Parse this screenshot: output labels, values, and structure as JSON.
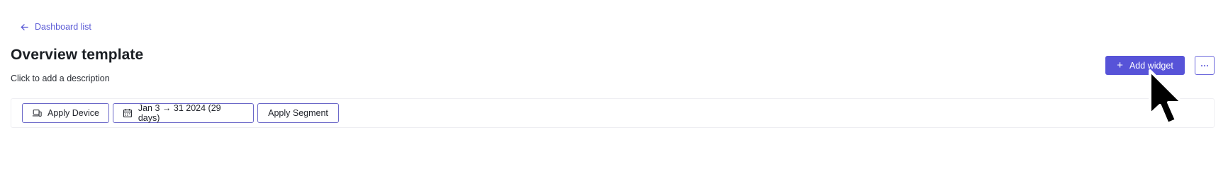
{
  "header": {
    "back_label": "Dashboard list",
    "title": "Overview template",
    "description_placeholder": "Click to add a description"
  },
  "actions": {
    "add_widget_label": "Add widget",
    "more_icon": "more-horizontal-icon"
  },
  "filters": [
    {
      "label": "Apply Device",
      "icon": "device-icon"
    },
    {
      "label": "Jan 3 → 31 2024 (29 days)",
      "icon": "calendar-icon"
    },
    {
      "label": "Apply Segment"
    }
  ],
  "colors": {
    "accent": "#5753d8",
    "link": "#5b5bd6",
    "border": "#6a67c8"
  }
}
